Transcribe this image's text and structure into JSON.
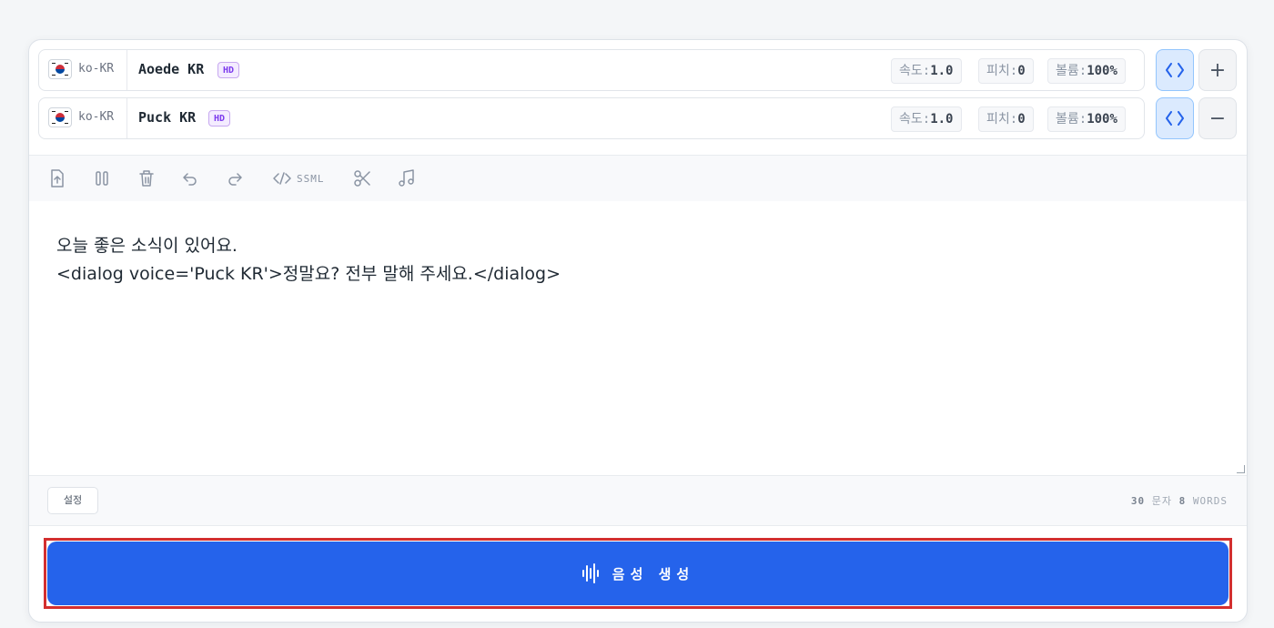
{
  "voices": [
    {
      "flag_icon": "south-korea-flag-icon",
      "lang_code": "ko-KR",
      "name": "Aoede KR",
      "badge": "HD",
      "speed_label": "속도:",
      "speed_value": "1.0",
      "pitch_label": "피치:",
      "pitch_value": "0",
      "volume_label": "볼륨:",
      "volume_value": "100%",
      "action_icon": "plus-icon",
      "action_symbol": "+"
    },
    {
      "flag_icon": "south-korea-flag-icon",
      "lang_code": "ko-KR",
      "name": "Puck KR",
      "badge": "HD",
      "speed_label": "속도:",
      "speed_value": "1.0",
      "pitch_label": "피치:",
      "pitch_value": "0",
      "volume_label": "볼륨:",
      "volume_value": "100%",
      "action_icon": "minus-icon",
      "action_symbol": "−"
    }
  ],
  "toolbar": {
    "items": [
      "upload-icon",
      "pause-icon",
      "trash-icon",
      "undo-icon",
      "redo-icon",
      "code-icon",
      "scissors-icon",
      "music-icon"
    ],
    "ssml_label": "SSML"
  },
  "editor": {
    "lines": [
      "오늘 좋은 소식이 있어요.",
      "<dialog voice='Puck KR'>정말요? 전부 말해 주세요.</dialog>"
    ]
  },
  "footer": {
    "settings_label": "설정",
    "char_count": "30",
    "char_unit": "문자",
    "word_count": "8",
    "word_unit": "WORDS"
  },
  "generate": {
    "label": "음성 생성",
    "icon": "waveform-icon"
  },
  "colors": {
    "accent": "#2563eb",
    "highlight_outline": "#d32f2f",
    "badge": "#7c3aed"
  }
}
